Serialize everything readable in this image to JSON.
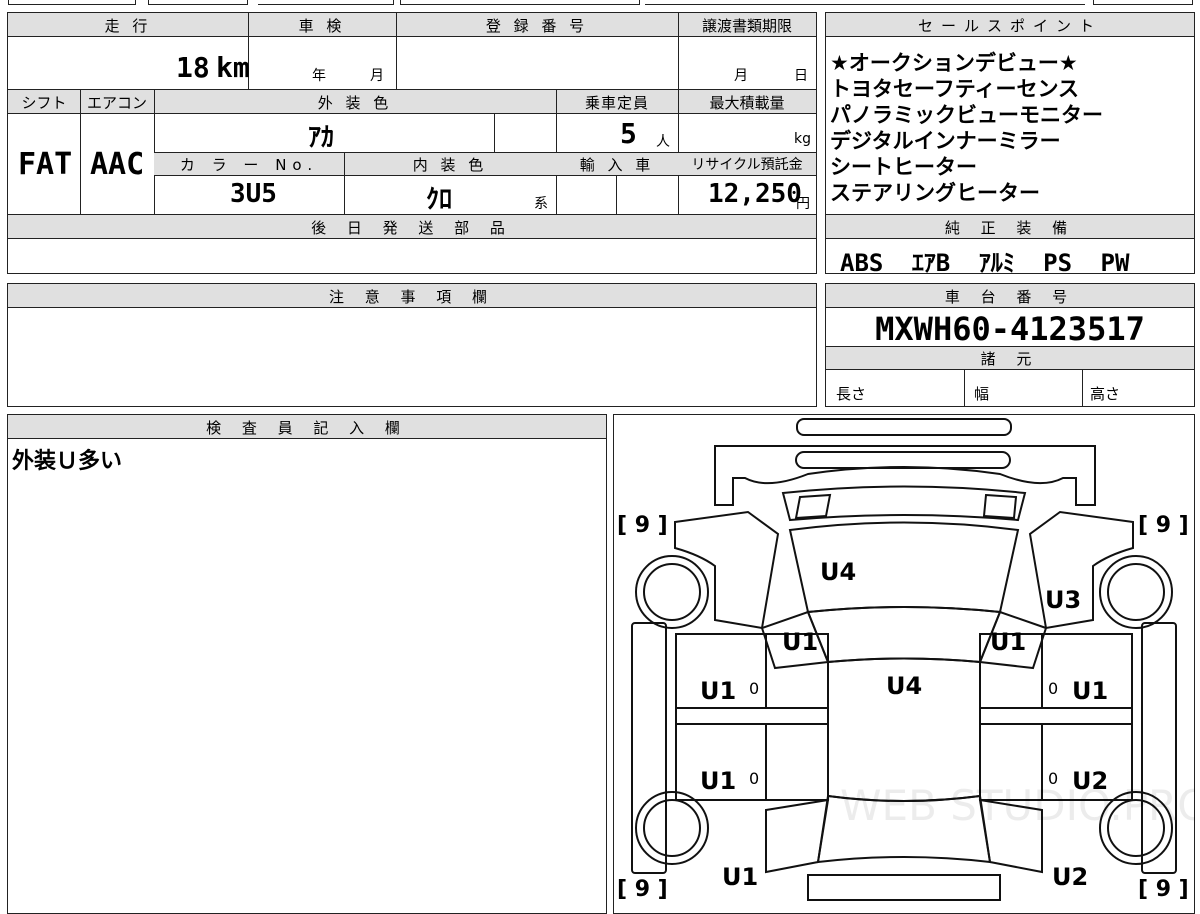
{
  "main": {
    "mileage_label": "走 行",
    "mileage_value": "18",
    "mileage_unit": "km",
    "shaken_label": "車 検",
    "shaken_year_unit": "年",
    "shaken_month_unit": "月",
    "registration_label": "登 録 番 号",
    "transfer_label": "譲渡書類期限",
    "transfer_month_unit": "月",
    "transfer_day_unit": "日",
    "shift_label": "シフト",
    "ac_label": "エアコン",
    "exterior_label": "外 装 色",
    "capacity_label": "乗車定員",
    "load_label": "最大積載量",
    "shift_value": "FAT",
    "ac_value": "AAC",
    "exterior_value": "ｱｶ",
    "capacity_value": "5",
    "capacity_unit": "人",
    "load_unit": "kg",
    "color_no_label": "カ ラ ー No.",
    "interior_label": "内 装 色",
    "import_label": "輸 入 車",
    "recycle_label": "リサイクル預託金",
    "color_no_value": "3U5",
    "interior_value": "ｸﾛ",
    "interior_suffix": "系",
    "recycle_value": "12,250",
    "recycle_unit": "円",
    "later_parts_label": "後 日 発 送 部 品"
  },
  "sales": {
    "label": "セールスポイント",
    "points": [
      "★オークションデビュー★",
      "トヨタセーフティーセンス",
      "パノラミックビューモニター",
      "デジタルインナーミラー",
      "シートヒーター",
      "ステアリングヒーター"
    ]
  },
  "equipment": {
    "label": "純 正 装 備",
    "items": [
      "ABS",
      "ｴｱB",
      "ｱﾙﾐ",
      "PS",
      "PW"
    ]
  },
  "notes": {
    "label": "注 意 事 項 欄"
  },
  "chassis": {
    "label": "車 台 番 号",
    "value": "MXWH60-4123517",
    "specs_label": "諸 元",
    "length_label": "長さ",
    "width_label": "幅",
    "height_label": "高さ"
  },
  "inspector": {
    "label": "検 査 員 記 入 欄",
    "comment": "外装Ｕ多い"
  },
  "diagram": {
    "watermark": "WEB STUDIO.PRO",
    "marks": {
      "fl_corner": "[ 9 ]",
      "fr_corner": "[ 9 ]",
      "rl_corner": "[ 9 ]",
      "rr_corner": "[ 9 ]",
      "hood": "U4",
      "front_right_fender": "U3",
      "left_pillar": "U1",
      "right_pillar": "U1",
      "roof": "U4",
      "left_front_door": "U1",
      "left_front_door_small": "0",
      "right_front_door": "U1",
      "right_front_door_small": "0",
      "left_rear_door": "U1",
      "left_rear_door_small": "0",
      "right_rear_door": "U2",
      "right_rear_door_small": "0",
      "left_rear_fender": "U1",
      "right_rear_fender": "U2"
    }
  }
}
